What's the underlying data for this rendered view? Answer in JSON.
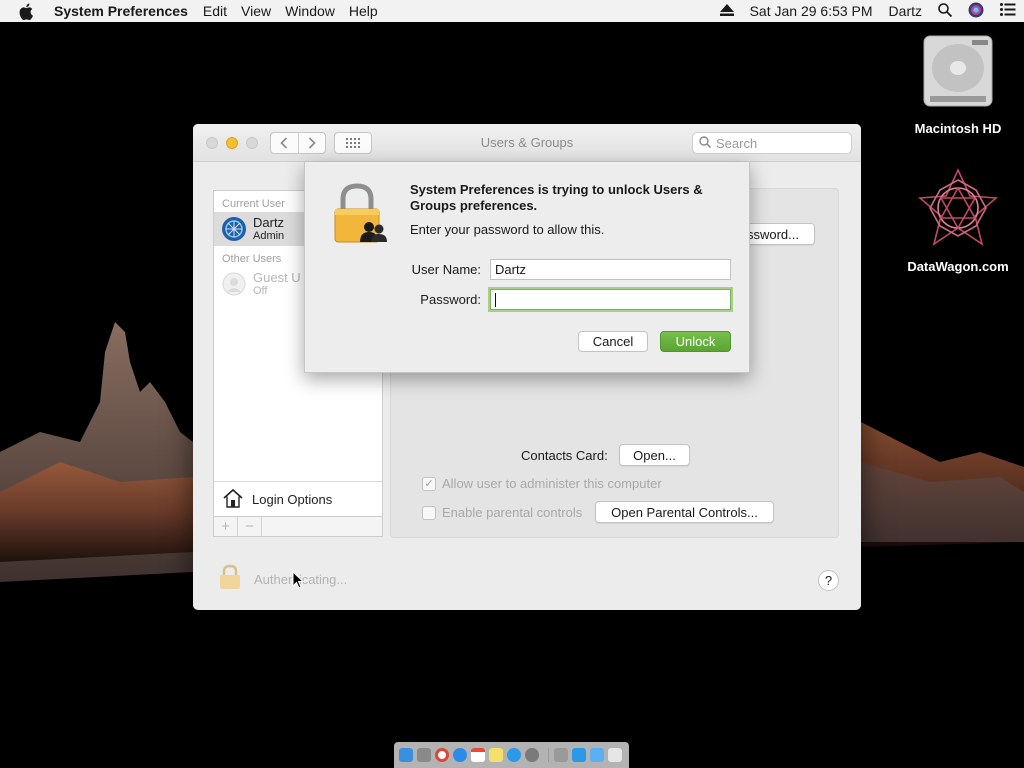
{
  "menubar": {
    "app_name": "System Preferences",
    "items": [
      "Edit",
      "View",
      "Window",
      "Help"
    ],
    "datetime": "Sat Jan 29  6:53 PM",
    "user": "Dartz"
  },
  "desktop": {
    "icons": [
      {
        "label": "Macintosh HD",
        "icon": "hard-drive-icon"
      },
      {
        "label": "DataWagon.com",
        "icon": "geometric-logo-icon"
      }
    ]
  },
  "window": {
    "title": "Users & Groups",
    "search_placeholder": "Search",
    "sidebar": {
      "current_user_header": "Current User",
      "current_user": {
        "name": "Dartz",
        "role": "Admin"
      },
      "other_users_header": "Other Users",
      "guest_user": {
        "name": "Guest U",
        "status": "Off"
      },
      "login_options_label": "Login Options",
      "add_label": "+",
      "remove_label": "−"
    },
    "content": {
      "change_password_label": "ssword...",
      "contacts_card_label": "Contacts Card:",
      "open_button_label": "Open...",
      "allow_admin_label": "Allow user to administer this computer",
      "allow_admin_checked": true,
      "parental_controls_label": "Enable parental controls",
      "parental_controls_checked": false,
      "open_parental_button_label": "Open Parental Controls..."
    },
    "bottom": {
      "status_text": "Authenticating...",
      "help_label": "?"
    }
  },
  "auth_sheet": {
    "title": "System Preferences is trying to unlock Users & Groups preferences.",
    "message": "Enter your password to allow this.",
    "username_label": "User Name:",
    "username_value": "Dartz",
    "password_label": "Password:",
    "password_value": "",
    "cancel_label": "Cancel",
    "unlock_label": "Unlock",
    "accent_color": "#5aa532"
  },
  "dock": {
    "items": [
      "finder-icon",
      "launchpad-icon",
      "chrome-icon",
      "safari-icon",
      "calendar-icon",
      "notes-icon",
      "app-store-icon",
      "system-preferences-icon",
      "separator",
      "utility-icon",
      "app-store-icon",
      "folder-icon",
      "trash-icon"
    ]
  }
}
